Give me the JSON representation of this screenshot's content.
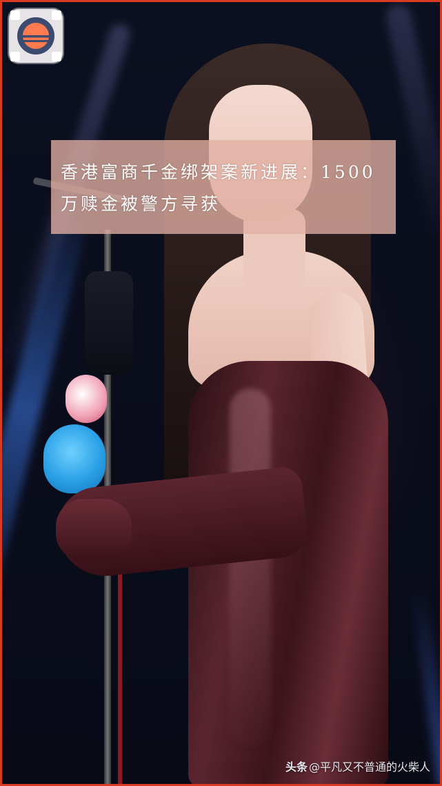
{
  "headline": {
    "text": "香港富商千金绑架案新进展：1500万赎金被警方寻获"
  },
  "watermark": {
    "brand": "头条",
    "handle": "@平凡又不普通的火柴人"
  },
  "app_icon": {
    "name": "sunset-app-icon"
  },
  "colors": {
    "frame_border": "#d83a23",
    "headline_bg": "#e2b0a3",
    "dress": "#5a2530"
  }
}
